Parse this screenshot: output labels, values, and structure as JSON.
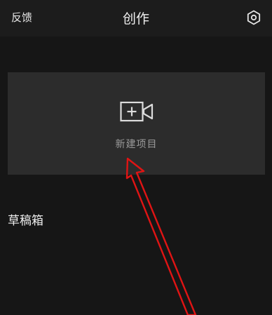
{
  "header": {
    "left_label": "反馈",
    "title": "创作",
    "settings_icon": "gear-icon"
  },
  "new_project": {
    "label": "新建项目",
    "icon": "video-add-icon"
  },
  "drafts": {
    "title": "草稿箱"
  },
  "colors": {
    "background": "#161616",
    "card": "#2c2c2c",
    "annotation": "#e01414"
  }
}
